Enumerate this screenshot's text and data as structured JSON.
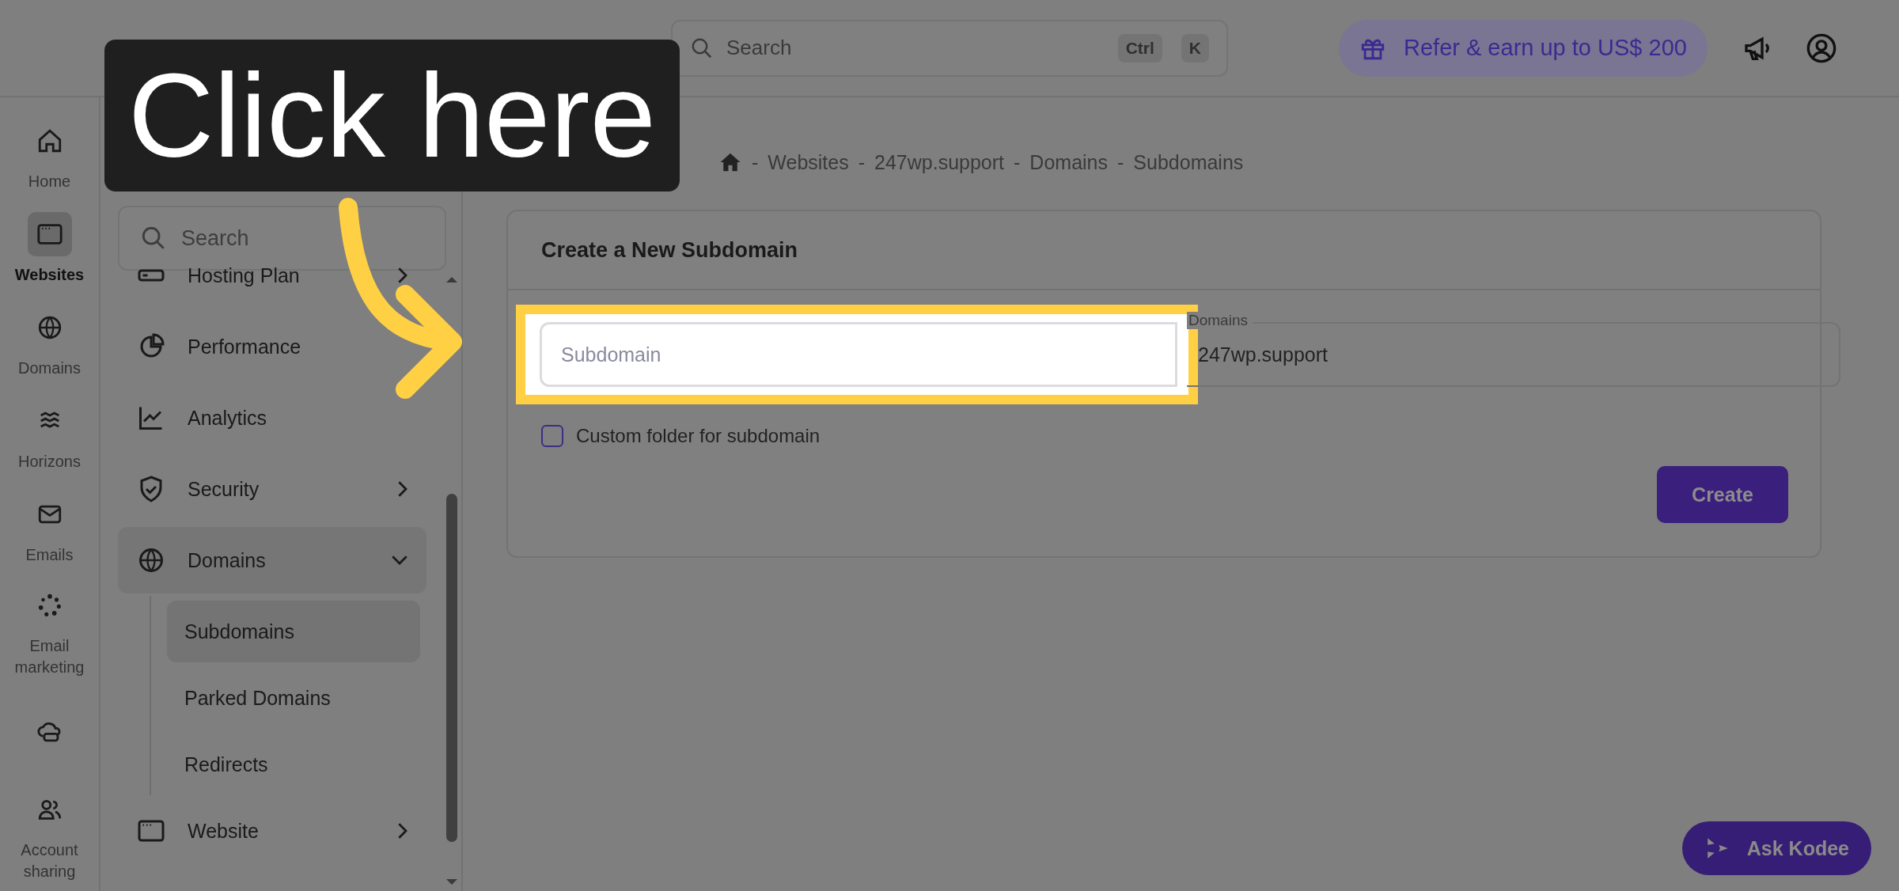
{
  "callout": {
    "text": "Click here"
  },
  "topbar": {
    "search": {
      "placeholder": "Search",
      "keys": [
        "Ctrl",
        "K"
      ]
    },
    "referral": "Refer & earn up to US$ 200"
  },
  "rail": [
    {
      "label": "Home",
      "selected": false
    },
    {
      "label": "Websites",
      "selected": true
    },
    {
      "label": "Domains",
      "selected": false
    },
    {
      "label": "Horizons",
      "selected": false
    },
    {
      "label": "Emails",
      "selected": false
    },
    {
      "label": "Email marketing",
      "selected": false
    },
    {
      "selected": false
    },
    {
      "label": "Account sharing",
      "selected": false
    }
  ],
  "sidebar": {
    "search": {
      "placeholder": "Search"
    },
    "items": [
      {
        "label": "Hosting Plan",
        "expandable": true,
        "expanded": false
      },
      {
        "label": "Performance",
        "expandable": false,
        "expanded": false
      },
      {
        "label": "Analytics",
        "expandable": false,
        "expanded": false
      },
      {
        "label": "Security",
        "expandable": true,
        "expanded": false
      },
      {
        "label": "Domains",
        "expandable": true,
        "expanded": true,
        "children": [
          {
            "label": "Subdomains",
            "selected": true
          },
          {
            "label": "Parked Domains",
            "selected": false
          },
          {
            "label": "Redirects",
            "selected": false
          }
        ]
      },
      {
        "label": "Website",
        "expandable": true,
        "expanded": false
      }
    ]
  },
  "breadcrumb": {
    "separator": "-",
    "items": [
      "Websites",
      "247wp.support",
      "Domains",
      "Subdomains"
    ]
  },
  "card": {
    "title": "Create a New Subdomain",
    "subdomain_field": {
      "placeholder": "Subdomain",
      "highlighted": true
    },
    "domain_field": {
      "label": "Domains",
      "value": "247wp.support"
    },
    "custom_folder": {
      "label": "Custom folder for subdomain",
      "checked": false
    },
    "create_button": "Create"
  },
  "assistant_button": "Ask Kodee"
}
